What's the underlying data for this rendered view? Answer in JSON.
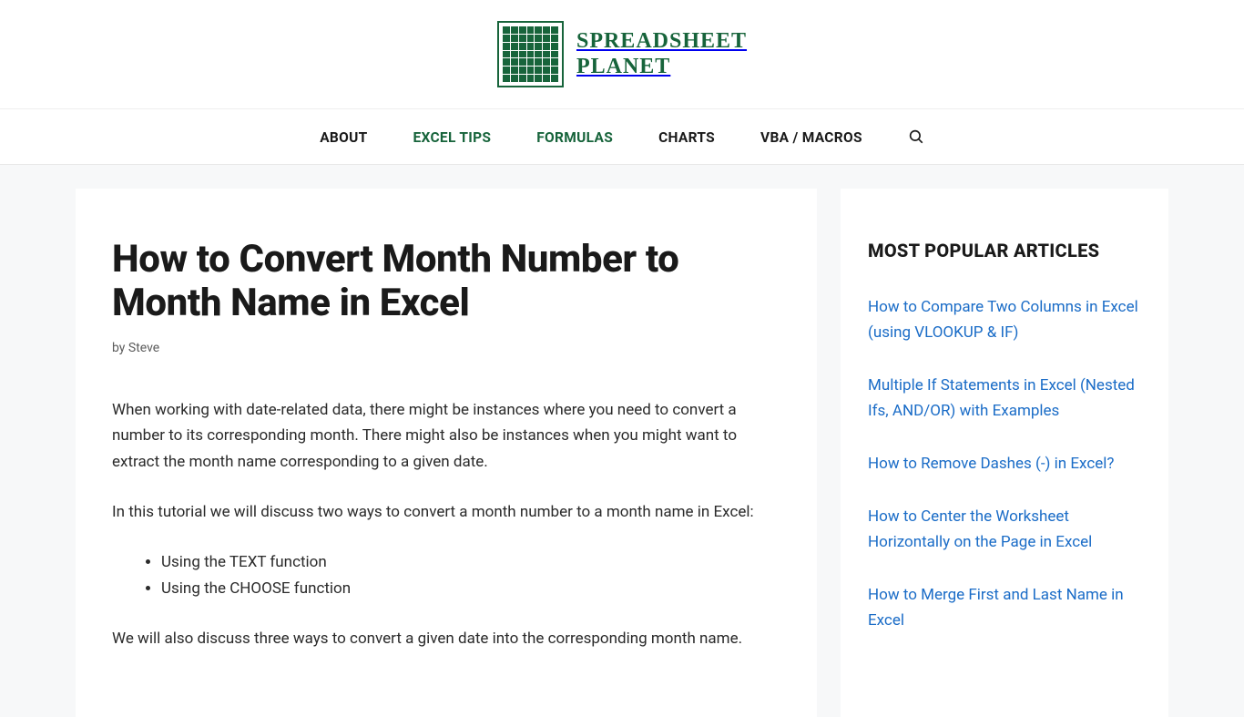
{
  "brand": {
    "line1": "SPREADSHEET",
    "line2": "PLANET"
  },
  "nav": {
    "items": [
      {
        "label": "ABOUT",
        "active": false
      },
      {
        "label": "EXCEL TIPS",
        "active": true
      },
      {
        "label": "FORMULAS",
        "active": true
      },
      {
        "label": "CHARTS",
        "active": false
      },
      {
        "label": "VBA / MACROS",
        "active": false
      }
    ]
  },
  "article": {
    "title": "How to Convert Month Number to Month Name in Excel",
    "byline_prefix": "by ",
    "author": "Steve",
    "p1": "When working with date-related data, there might be instances where you need to convert a number to its corresponding month. There might also be instances when you might want to extract the month name corresponding to a given date.",
    "p2": "In this tutorial we will discuss two ways to convert a month number to a month name in Excel:",
    "methods": [
      "Using the TEXT function",
      "Using the CHOOSE function"
    ],
    "p3": "We will also discuss three ways to convert a given date into the corresponding month name."
  },
  "sidebar": {
    "heading": "MOST POPULAR ARTICLES",
    "links": [
      "How to Compare Two Columns in Excel (using VLOOKUP & IF)",
      "Multiple If Statements in Excel (Nested Ifs, AND/OR) with Examples",
      "How to Remove Dashes (-) in Excel?",
      "How to Center the Worksheet Horizontally on the Page in Excel",
      "How to Merge First and Last Name in Excel"
    ]
  }
}
